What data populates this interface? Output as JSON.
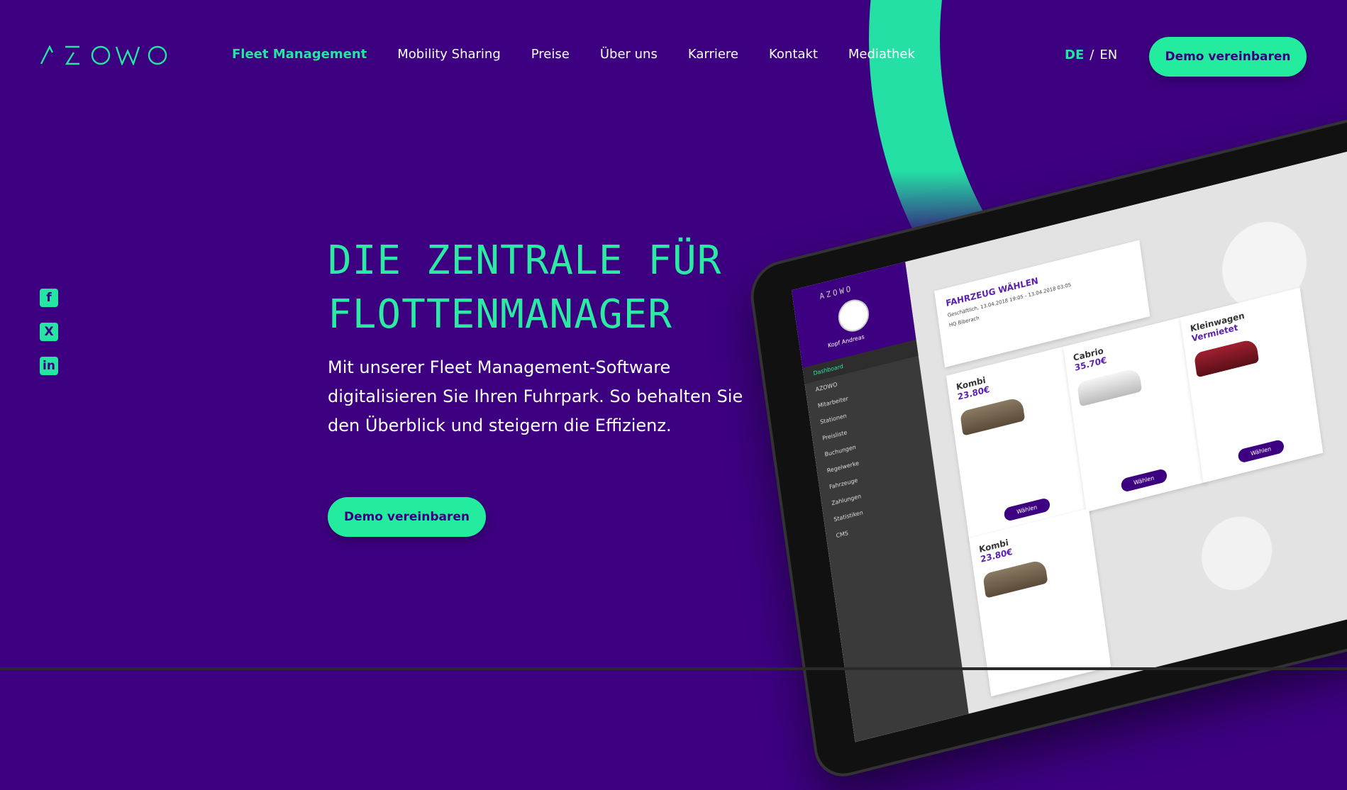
{
  "brand": {
    "logo_text": "AZOWO",
    "accent": "#24e6a2",
    "background": "#3d0080"
  },
  "nav": {
    "items": [
      {
        "label": "Fleet Management",
        "active": true
      },
      {
        "label": "Mobility Sharing"
      },
      {
        "label": "Preise"
      },
      {
        "label": "Über uns"
      },
      {
        "label": "Karriere"
      },
      {
        "label": "Kontakt"
      },
      {
        "label": "Mediathek"
      }
    ],
    "lang_de": "DE",
    "lang_sep": "/",
    "lang_en": "EN",
    "cta": "Demo vereinbaren"
  },
  "social": [
    {
      "icon": "facebook-icon",
      "glyph": "f"
    },
    {
      "icon": "xing-icon",
      "glyph": "X"
    },
    {
      "icon": "linkedin-icon",
      "glyph": "in"
    }
  ],
  "hero": {
    "headline_line1": "DIE ZENTRALE FÜR",
    "headline_line2": "FLOTTENMANAGER",
    "subline": "Mit unserer Fleet Management-Software digitalisieren Sie Ihren Fuhrpark. So behalten Sie den Überblick und steigern die Effizienz.",
    "cta": "Demo vereinbaren"
  },
  "tablet": {
    "user_name": "Kopf Andreas",
    "sidebar": [
      "Dashboard",
      "AZOWO",
      "Mitarbeiter",
      "Stationen",
      "Preisliste",
      "Buchungen",
      "Regelwerke",
      "Fahrzeuge",
      "Zahlungen",
      "Statistiken",
      "CMS"
    ],
    "select_title": "FAHRZEUG WÄHLEN",
    "select_meta": "Geschäftlich, 13.04.2018 19:05 - 13.04.2018 03:05",
    "station": "HQ Biberach",
    "cards": [
      {
        "title": "Kombi",
        "price": "23.80€",
        "button": "Wählen"
      },
      {
        "title": "Cabrio",
        "price": "35.70€",
        "button": "Wählen"
      },
      {
        "title": "Kleinwagen",
        "price": "Vermietet",
        "button": "Wählen"
      },
      {
        "title": "Kombi",
        "price": "23.80€"
      }
    ]
  }
}
